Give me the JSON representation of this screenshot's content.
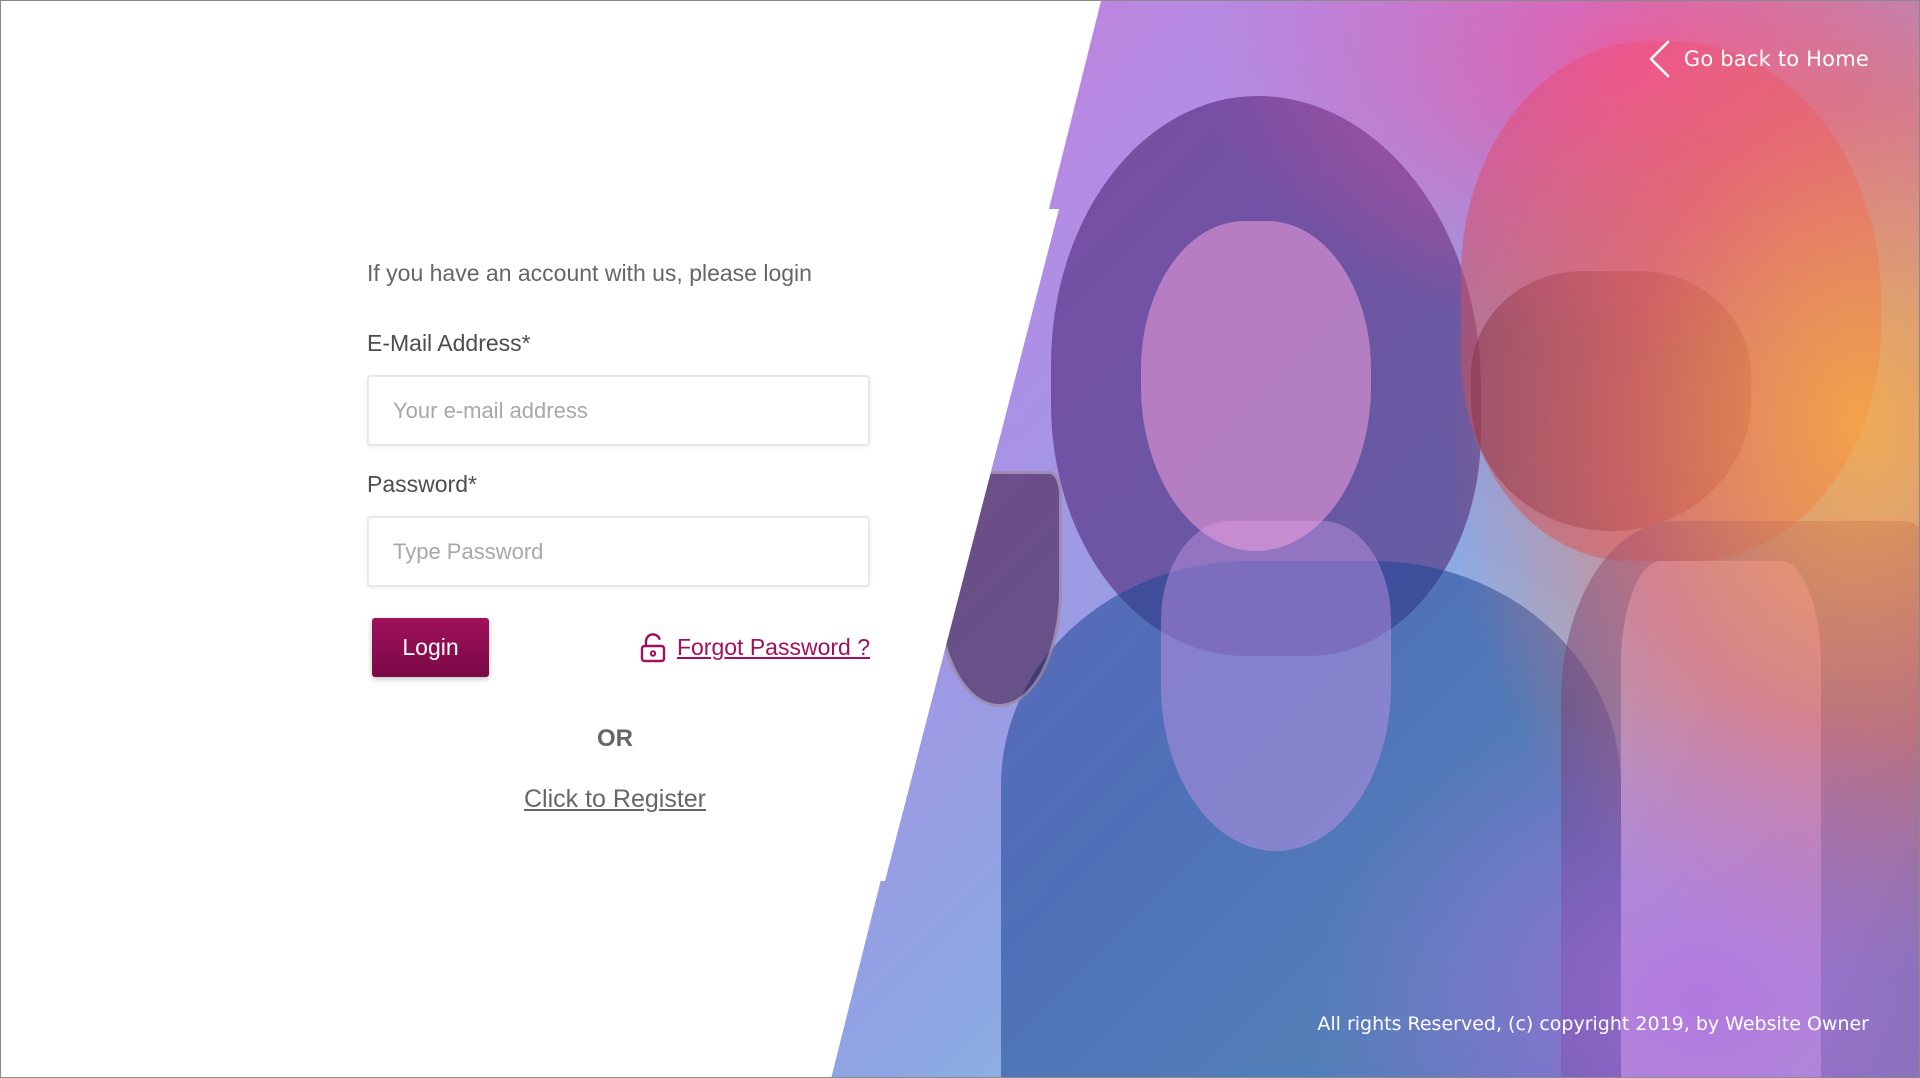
{
  "colors": {
    "accent": "#a0105c",
    "accent_dark": "#7a0a46",
    "text_muted": "#666666",
    "label": "#4d4d4d",
    "placeholder": "#a8a8a8"
  },
  "header": {
    "back_icon": "chevron-left-icon",
    "back_label": "Go back to Home"
  },
  "login_form": {
    "intro": "If you have an account with us, please login",
    "email_label": "E-Mail Address*",
    "email_placeholder": "Your e-mail address",
    "email_value": "",
    "password_label": "Password*",
    "password_placeholder": "Type Password",
    "password_value": "",
    "login_button": "Login",
    "forgot_icon": "unlock-icon",
    "forgot_label": "Forgot Password ?",
    "or_label": "OR",
    "register_label": "Click to Register"
  },
  "footer": {
    "copyright": "All rights Reserved, (c) copyright 2019, by Website Owner"
  }
}
